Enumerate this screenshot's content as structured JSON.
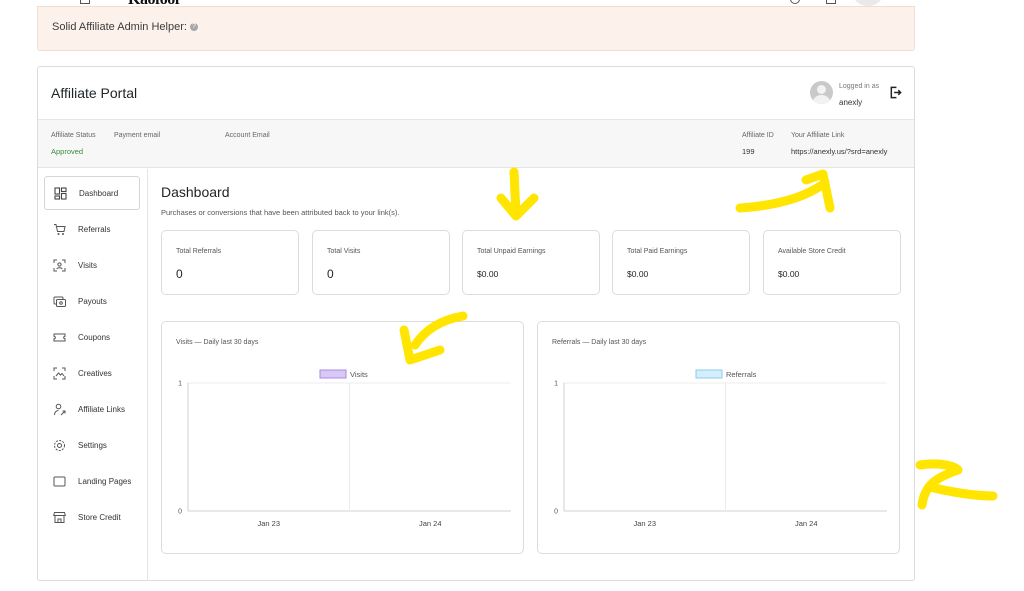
{
  "helper": {
    "text": "Solid Affiliate Admin Helper:"
  },
  "portal": {
    "title": "Affiliate Portal",
    "logged_in_label": "Logged in as",
    "username": "anexly"
  },
  "info": {
    "status_label": "Affiliate Status",
    "status_value": "Approved",
    "payment_email_label": "Payment email",
    "account_email_label": "Account Email",
    "affiliate_id_label": "Affiliate ID",
    "affiliate_id_value": "199",
    "link_label": "Your Affiliate Link",
    "link_value": "https://anexly.us/?srd=anexly"
  },
  "sidebar": {
    "items": [
      {
        "label": "Dashboard",
        "icon": "dashboard-icon",
        "active": true
      },
      {
        "label": "Referrals",
        "icon": "cart-icon"
      },
      {
        "label": "Visits",
        "icon": "visits-icon"
      },
      {
        "label": "Payouts",
        "icon": "payouts-icon"
      },
      {
        "label": "Coupons",
        "icon": "coupon-icon"
      },
      {
        "label": "Creatives",
        "icon": "creatives-icon"
      },
      {
        "label": "Affiliate Links",
        "icon": "user-link-icon"
      },
      {
        "label": "Settings",
        "icon": "gear-icon"
      },
      {
        "label": "Landing Pages",
        "icon": "landing-page-icon"
      },
      {
        "label": "Store Credit",
        "icon": "store-icon"
      }
    ]
  },
  "dashboard": {
    "title": "Dashboard",
    "subtitle": "Purchases or conversions that have been attributed back to your link(s).",
    "stats": [
      {
        "label": "Total Referrals",
        "value": "0"
      },
      {
        "label": "Total Visits",
        "value": "0"
      },
      {
        "label": "Total Unpaid Earnings",
        "value": "$0.00"
      },
      {
        "label": "Total Paid Earnings",
        "value": "$0.00"
      },
      {
        "label": "Available Store Credit",
        "value": "$0.00"
      }
    ]
  },
  "chart_data": [
    {
      "type": "bar",
      "title": "Visits — Daily last 30 days",
      "categories": [
        "Jan 23",
        "Jan 24"
      ],
      "series": [
        {
          "name": "Visits",
          "values": [
            0,
            0
          ],
          "color": "#d9c8f5",
          "border": "#a98be0"
        }
      ],
      "ylim": [
        0,
        1
      ],
      "yticks": [
        "0",
        "1"
      ],
      "grid": true,
      "legend": "top-center"
    },
    {
      "type": "bar",
      "title": "Referrals — Daily last 30 days",
      "categories": [
        "Jan 23",
        "Jan 24"
      ],
      "series": [
        {
          "name": "Referrals",
          "values": [
            0,
            0
          ],
          "color": "#d4eefb",
          "border": "#8fcbea"
        }
      ],
      "ylim": [
        0,
        1
      ],
      "yticks": [
        "0",
        "1"
      ],
      "grid": true,
      "legend": "top-center"
    }
  ],
  "colors": {
    "annotation": "#ffe500",
    "approved": "#3b8a3f",
    "border": "#dcdcde"
  }
}
